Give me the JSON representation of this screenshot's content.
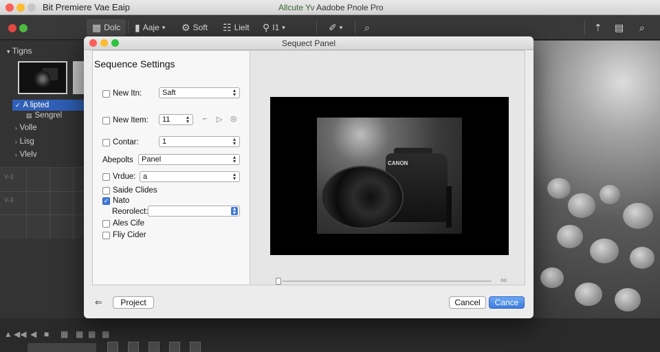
{
  "window": {
    "app_title": "Bit Premiere Vae Eaip",
    "doc_title_accent": "Allcute Yv",
    "doc_title": "Aadobe Pnole Pro"
  },
  "toolbar": {
    "doc_label": "Dolc",
    "age_label": "Aaje",
    "soft_label": "Soft",
    "list_label": "Lielt",
    "filter_label": "I1",
    "share_icon": "share-icon",
    "search_icon": "search-icon"
  },
  "left_panel": {
    "heading": "Tigns",
    "items": [
      {
        "label": "A lipted",
        "selected": true
      },
      {
        "label": "Sengrel"
      },
      {
        "label": "Volle"
      },
      {
        "label": "Lisg"
      },
      {
        "label": "Vlelv"
      }
    ],
    "grid_labels": [
      "V-3",
      "V-3"
    ]
  },
  "dialog": {
    "title": "Sequect Panel",
    "section_title": "Sequence Settings",
    "fields": {
      "new_item_1": {
        "label": "New Itn:",
        "value": "Saft",
        "checked": false
      },
      "new_item_2": {
        "label": "New Item:",
        "value": "11",
        "checked": false
      },
      "contar": {
        "label": "Contar:",
        "value": "1",
        "checked": false
      },
      "abepolts": {
        "label": "Abepolts",
        "value": "Panel"
      },
      "vrdue": {
        "label": "Vrdue:",
        "value": "a",
        "checked": false
      },
      "saide_clides": {
        "label": "Saide Clides",
        "checked": false
      },
      "nato": {
        "label": "Nato",
        "checked": true
      },
      "reorolect": {
        "label": "Reorolect:",
        "value": ""
      },
      "ales_cife": {
        "label": "Ales Cife",
        "checked": false
      },
      "fliy_cider": {
        "label": "Fliy Cider",
        "checked": false
      }
    },
    "preview": {
      "camera_label": "CANON",
      "scrub_end_label": "oo",
      "playhead_position": 0
    },
    "buttons": {
      "project": "Project",
      "cancel": "Cancel",
      "confirm": "Cance"
    }
  },
  "colors": {
    "accent_blue": "#3d7be0",
    "selection_blue": "#2f5fb6"
  }
}
